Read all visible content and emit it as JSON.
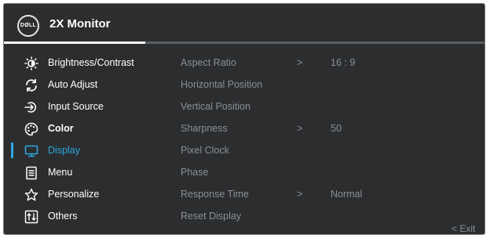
{
  "header": {
    "logo_text": "DØLL",
    "title": "2X Monitor"
  },
  "menu": [
    {
      "label": "Brightness/Contrast",
      "icon": "brightness-icon",
      "sub": "Aspect Ratio",
      "value": "16 : 9",
      "arrow": ">"
    },
    {
      "label": "Auto Adjust",
      "icon": "auto-adjust-icon",
      "sub": "Horizontal Position",
      "value": "",
      "arrow": ""
    },
    {
      "label": "Input Source",
      "icon": "input-source-icon",
      "sub": "Vertical Position",
      "value": "",
      "arrow": ""
    },
    {
      "label": "Color",
      "icon": "color-palette-icon",
      "sub": "Sharpness",
      "value": "50",
      "arrow": ">"
    },
    {
      "label": "Display",
      "icon": "display-icon",
      "sub": "Pixel Clock",
      "value": "",
      "arrow": ""
    },
    {
      "label": "Menu",
      "icon": "menu-icon",
      "sub": "Phase",
      "value": "",
      "arrow": ""
    },
    {
      "label": "Personalize",
      "icon": "star-icon",
      "sub": "Response Time",
      "value": "Normal",
      "arrow": ">"
    },
    {
      "label": "Others",
      "icon": "others-icon",
      "sub": "Reset Display",
      "value": "",
      "arrow": ""
    }
  ],
  "exit": {
    "label": "< Exit"
  },
  "colors": {
    "background": "#2b2d2f",
    "accent": "#2ea7e0",
    "text": "#ffffff",
    "muted": "#8c9094"
  }
}
